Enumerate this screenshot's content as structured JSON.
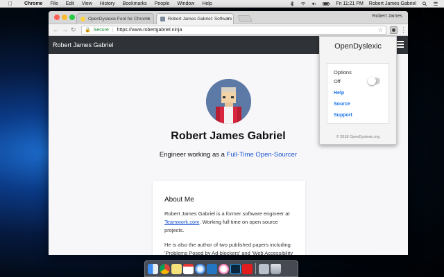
{
  "menubar": {
    "app": "Chrome",
    "items": [
      "File",
      "Edit",
      "View",
      "History",
      "Bookmarks",
      "People",
      "Window",
      "Help"
    ],
    "clock": "Fri 11:21 PM",
    "user": "Robert James Gabriel"
  },
  "browser": {
    "tabs": [
      {
        "title": "OpenDyslexic Font for Chrome",
        "active": false
      },
      {
        "title": "Robert James Gabriel: Software",
        "active": true
      }
    ],
    "profile": "Robert James",
    "address": {
      "secure_label": "Secure",
      "url": "https://www.robertgabriel.ninja"
    }
  },
  "page": {
    "brand": "Robert James Gabriel",
    "name": "Robert James Gabriel",
    "tagline_prefix": "Engineer working as a",
    "tagline_link": "Full-Time Open-Sourcer",
    "about": {
      "heading": "About Me",
      "p1_before": "Robert James Gabriel is a former software engineer at",
      "p1_link": "Teamwork.com",
      "p1_after": ". Working full time on open source projects.",
      "p2": "He is also the author of two published papers including 'Problems Posed by Ad-blockers' and 'Web Accessibility and OpenDyslexia'."
    }
  },
  "popup": {
    "title": "OpenDyslexic",
    "options_label": "Options",
    "toggle_state": "Off",
    "toggle_on": false,
    "links": [
      "Help",
      "Source",
      "Support"
    ],
    "footer": "© 2018 OpenDyslexic.org"
  },
  "colors": {
    "link": "#1a55d0",
    "popup_link": "#1a73e8",
    "nav_bg": "#2f3237",
    "secure": "#1a8a34"
  },
  "dock": {
    "icons": [
      "finder-icon",
      "chrome-icon",
      "notes-icon",
      "calendar-icon",
      "safari-icon",
      "vscode-icon",
      "itunes-icon",
      "photoshop-icon",
      "acrobat-icon",
      "preview-icon",
      "trash-icon"
    ]
  }
}
